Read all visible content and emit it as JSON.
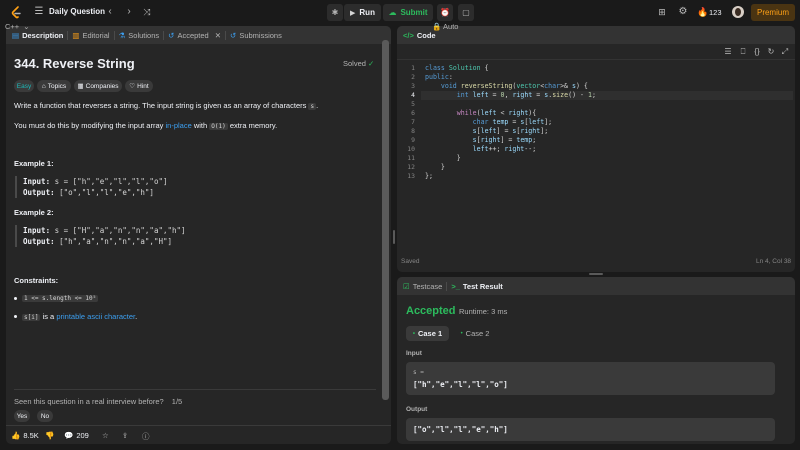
{
  "topbar": {
    "title": "Daily Question",
    "run_label": "Run",
    "submit_label": "Submit",
    "streak": "123",
    "premium_label": "Premium"
  },
  "description_tabs": [
    {
      "label": "Description"
    },
    {
      "label": "Editorial"
    },
    {
      "label": "Solutions"
    },
    {
      "label": "Accepted"
    },
    {
      "label": "Submissions"
    }
  ],
  "problem": {
    "title": "344. Reverse String",
    "status": "Solved",
    "difficulty": "Easy",
    "tags": [
      "Topics",
      "Companies",
      "Hint"
    ],
    "p1_text": "Write a function that reverses a string. The input string is given as an array of characters",
    "p1_code": "s",
    "p1_end": ".",
    "p2_a": "You must do this by modifying the input array",
    "p2_link": "in-place",
    "p2_b": "with",
    "p2_code": "O(1)",
    "p2_c": "extra memory.",
    "examples": [
      {
        "title": "Example 1:",
        "input_label": "Input:",
        "input": "s = [\"h\",\"e\",\"l\",\"l\",\"o\"]",
        "output_label": "Output:",
        "output": "[\"o\",\"l\",\"l\",\"e\",\"h\"]"
      },
      {
        "title": "Example 2:",
        "input_label": "Input:",
        "input": "s = [\"H\",\"a\",\"n\",\"n\",\"a\",\"h\"]",
        "output_label": "Output:",
        "output": "[\"h\",\"a\",\"n\",\"n\",\"a\",\"H\"]"
      }
    ],
    "constraints_title": "Constraints:",
    "constraint1_code": "1 <= s.length <= 10⁵",
    "constraint2_code": "s[i]",
    "constraint2_a": "is a",
    "constraint2_link": "printable ascii character",
    "constraint2_end": ".",
    "interview_q": "Seen this question in a real interview before?",
    "interview_page": "1/5",
    "yes_label": "Yes",
    "no_label": "No",
    "likes": "8.5K",
    "comments": "209"
  },
  "code_panel": {
    "title": "Code",
    "language": "C++",
    "auto": "Auto",
    "lines": [
      "class Solution {",
      "public:",
      "    void reverseString(vector<char>& s) {",
      "        int left = 0, right = s.size() - 1;",
      "",
      "        while(left < right){",
      "            char temp = s[left];",
      "            s[left] = s[right];",
      "            s[right] = temp;",
      "            left++; right--;",
      "        }",
      "    }",
      "};"
    ],
    "status_left": "Saved",
    "status_right": "Ln 4, Col 38"
  },
  "result_panel": {
    "tabs": [
      {
        "label": "Testcase"
      },
      {
        "label": "Test Result"
      }
    ],
    "verdict": "Accepted",
    "runtime": "Runtime: 3 ms",
    "cases": [
      {
        "label": "Case 1"
      },
      {
        "label": "Case 2"
      }
    ],
    "input_label": "Input",
    "input_var": "s =",
    "input_value": "[\"h\",\"e\",\"l\",\"l\",\"o\"]",
    "output_label": "Output",
    "output_value": "[\"o\",\"l\",\"l\",\"e\",\"h\"]"
  },
  "colors": {
    "accent": "#ffa116",
    "accepted": "#2cbb5d",
    "easy": "#1cbaba",
    "link": "#3c9ff0",
    "panel": "#262626",
    "background": "#1a1a1a"
  }
}
